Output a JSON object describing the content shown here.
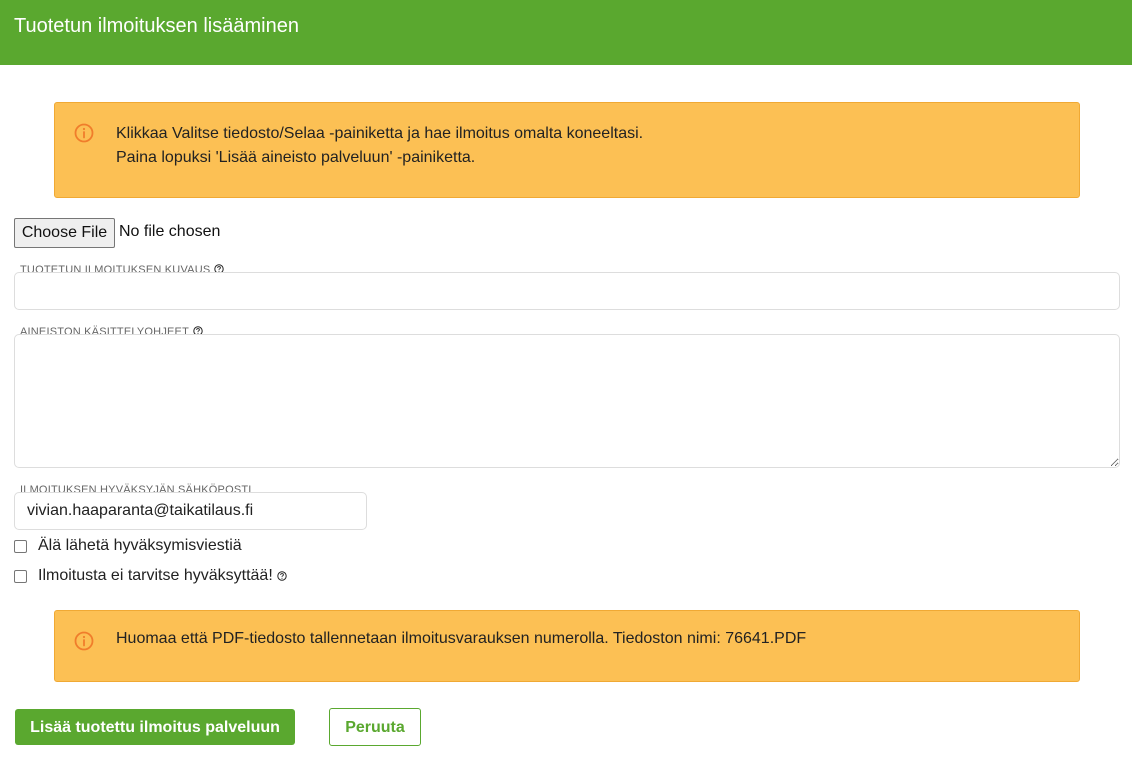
{
  "header": {
    "title": "Tuotetun ilmoituksen lisääminen",
    "background_color": "#5aa82f"
  },
  "info_alert": {
    "icon": "info-circle-icon",
    "line1": "Klikkaa Valitse tiedosto/Selaa -painiketta ja hae ilmoitus omalta koneeltasi.",
    "line2": "Paina lopuksi 'Lisää aineisto palveluun' -painiketta.",
    "background_color": "#fcc054"
  },
  "file_input": {
    "button_label": "Choose File",
    "status": "No file chosen"
  },
  "description_field": {
    "label": "TUOTETUN ILMOITUKSEN KUVAUS",
    "help_icon": "question-circle-icon",
    "value": ""
  },
  "notes_field": {
    "label": "AINEISTON KÄSITTELYOHJEET",
    "help_icon": "question-circle-icon",
    "value": ""
  },
  "approver_email_field": {
    "label": "ILMOITUKSEN HYVÄKSYJÄN SÄHKÖPOSTI",
    "value": "vivian.haaparanta@taikatilaus.fi"
  },
  "checkboxes": [
    {
      "label": "Älä lähetä hyväksymisviestiä",
      "checked": false
    },
    {
      "label": "Ilmoitusta ei tarvitse hyväksyttää!",
      "checked": false,
      "help_icon": "question-circle-icon"
    }
  ],
  "filename_alert": {
    "icon": "info-circle-icon",
    "text": "Huomaa että PDF-tiedosto tallennetaan ilmoitusvarauksen numerolla. Tiedoston nimi: 76641.PDF"
  },
  "actions": {
    "submit_label": "Lisää tuotettu ilmoitus palveluun",
    "cancel_label": "Peruuta",
    "accent_color": "#5aa82f"
  }
}
